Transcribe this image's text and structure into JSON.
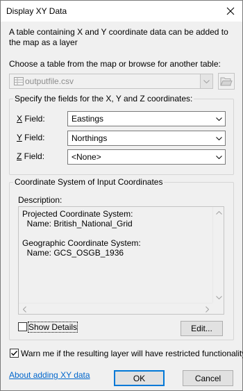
{
  "window": {
    "title": "Display XY Data",
    "close_icon": "close-icon"
  },
  "intro_text": "A table containing X and Y coordinate data can be added to the map as a layer",
  "table_chooser": {
    "label": "Choose a table from the map or browse for another table:",
    "value": "outputfile.csv",
    "browse_icon": "open-folder-icon",
    "disabled": true
  },
  "fields_group": {
    "legend": "Specify the fields for the X, Y and Z coordinates:",
    "x_field": {
      "mnemonic": "X",
      "label_rest": " Field:",
      "value": "Eastings"
    },
    "y_field": {
      "mnemonic": "Y",
      "label_rest": " Field:",
      "value": "Northings"
    },
    "z_field": {
      "mnemonic": "Z",
      "label_rest": " Field:",
      "value": "<None>"
    }
  },
  "coord_group": {
    "legend": "Coordinate System of Input Coordinates",
    "description_label": "Description:",
    "description_text": "Projected Coordinate System:\n  Name: British_National_Grid\n\nGeographic Coordinate System:\n  Name: GCS_OSGB_1936",
    "show_details": {
      "label": "Show Details",
      "checked": false
    },
    "edit_button": "Edit..."
  },
  "warn_checkbox": {
    "label": "Warn me if the resulting layer will have restricted functionality",
    "checked": true
  },
  "about_link": "About adding XY data",
  "ok_button": "OK",
  "cancel_button": "Cancel",
  "colors": {
    "link": "#0066cc",
    "default_button_border": "#0078d7",
    "dialog_bg": "#f0f0f0"
  }
}
